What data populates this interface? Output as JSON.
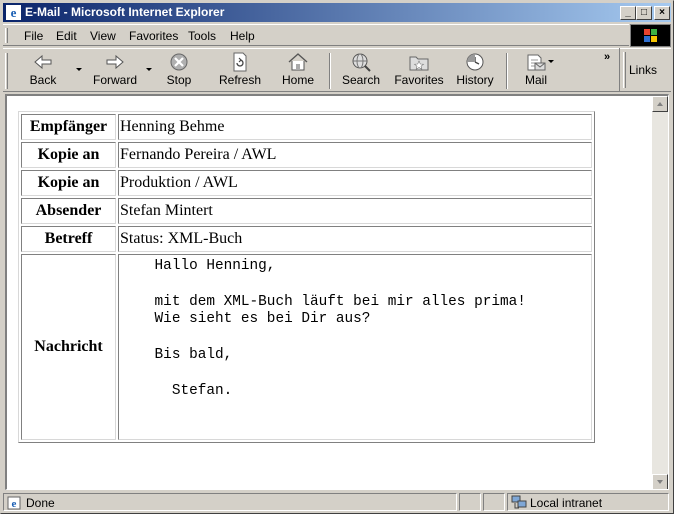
{
  "window": {
    "title": "E-Mail - Microsoft Internet Explorer",
    "minimize": "_",
    "maximize": "□",
    "close": "×"
  },
  "menu": [
    "File",
    "Edit",
    "View",
    "Favorites",
    "Tools",
    "Help"
  ],
  "toolbar": {
    "back": "Back",
    "forward": "Forward",
    "stop": "Stop",
    "refresh": "Refresh",
    "home": "Home",
    "search": "Search",
    "favorites": "Favorites",
    "history": "History",
    "mail": "Mail",
    "links": "Links",
    "chevron": "»"
  },
  "email": {
    "rows": [
      {
        "label": "Empfänger",
        "value": "Henning Behme"
      },
      {
        "label": "Kopie an",
        "value": "Fernando Pereira / AWL"
      },
      {
        "label": "Kopie an",
        "value": "Produktion / AWL"
      },
      {
        "label": "Absender",
        "value": "Stefan Mintert"
      },
      {
        "label": "Betreff",
        "value": "Status: XML-Buch"
      }
    ],
    "message_label": "Nachricht",
    "message_body": "    Hallo Henning,\n\n    mit dem XML-Buch läuft bei mir alles prima!\n    Wie sieht es bei Dir aus?\n\n    Bis bald,\n\n      Stefan."
  },
  "status": {
    "text": "Done",
    "zone": "Local intranet"
  },
  "colors": {
    "titlebar_start": "#0a246a",
    "titlebar_end": "#a6caf0",
    "chrome": "#d4d0c8"
  }
}
